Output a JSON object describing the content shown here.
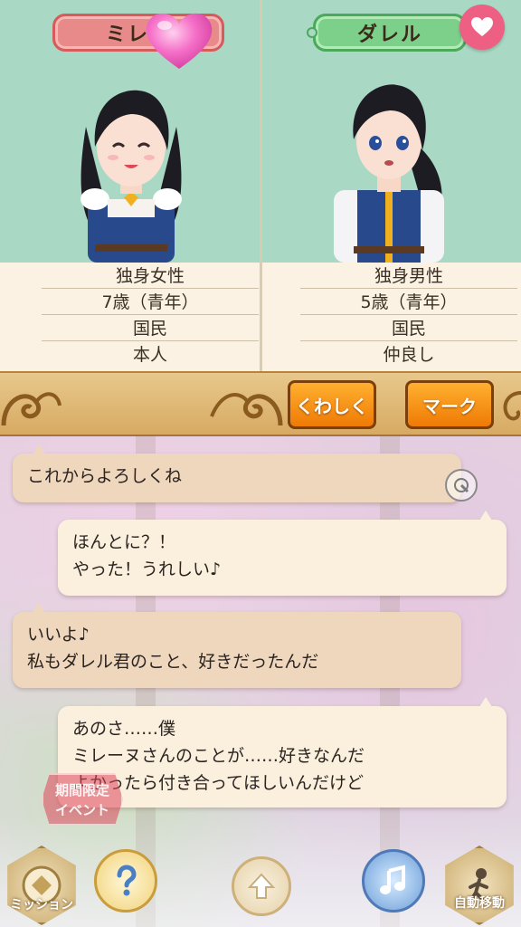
{
  "characters": {
    "left": {
      "name": "ミレーヌ",
      "label_visible": "ミレー",
      "info": [
        "独身女性",
        "7歳（青年）",
        "国民",
        "本人"
      ]
    },
    "right": {
      "name": "ダレル",
      "info": [
        "独身男性",
        "5歳（青年）",
        "国民",
        "仲良し"
      ]
    }
  },
  "actions": {
    "detail_label": "くわしく",
    "mark_label": "マーク"
  },
  "chat": [
    {
      "speaker": "left",
      "text": "これからよろしくね"
    },
    {
      "speaker": "right",
      "lines": [
        "ほんとに？！",
        "やった！うれしい♪"
      ]
    },
    {
      "speaker": "left",
      "lines": [
        "いいよ♪",
        "私もダレル君のこと、好きだったんだ"
      ]
    },
    {
      "speaker": "right",
      "lines": [
        "あのさ……僕",
        "ミレーヌさんのことが……好きなんだ",
        "よかったら付き合ってほしいんだけど"
      ]
    }
  ],
  "dock": {
    "mission_label": "ミッション",
    "automove_label": "自動移動",
    "event_label_1": "期間限定",
    "event_label_2": "イベント"
  },
  "icons": {
    "heart": "heart-icon",
    "fav": "heart-icon",
    "ar": "ar-bubble-icon",
    "help": "question-icon",
    "up": "up-arrow-icon",
    "music": "music-note-icon"
  },
  "colors": {
    "left_tag": "#e88a8a",
    "right_tag": "#7cd08a",
    "portrait_bg": "#a9d8c4",
    "action_button": "#f59a1c",
    "fav_button": "#ee5f84"
  }
}
